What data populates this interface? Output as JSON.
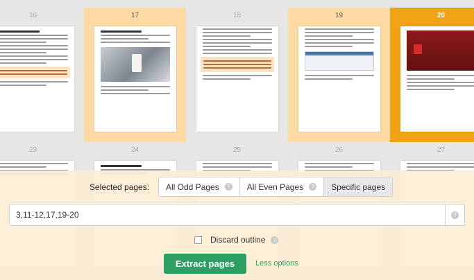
{
  "thumbnails": {
    "row1": [
      {
        "number": "16",
        "state": "normal",
        "content": "text"
      },
      {
        "number": "17",
        "state": "selected",
        "content": "photo"
      },
      {
        "number": "18",
        "state": "normal",
        "content": "highlight"
      },
      {
        "number": "19",
        "state": "selected",
        "content": "screenshot"
      },
      {
        "number": "20",
        "state": "current",
        "content": "red-screenshot"
      }
    ],
    "row2": [
      {
        "number": "23"
      },
      {
        "number": "24"
      },
      {
        "number": "25"
      },
      {
        "number": "26"
      },
      {
        "number": "27"
      }
    ]
  },
  "selection": {
    "label": "Selected pages:",
    "options": [
      {
        "label": "All Odd Pages",
        "help_icon": "help-icon"
      },
      {
        "label": "All Even Pages",
        "help_icon": "help-icon"
      },
      {
        "label": "Specific pages",
        "active": true
      }
    ]
  },
  "range_input": {
    "value": "3,11-12,17,19-20",
    "help_icon": "help-icon"
  },
  "discard_outline": {
    "label": "Discard outline",
    "checked": false,
    "help_icon": "help-icon"
  },
  "actions": {
    "extract_label": "Extract pages",
    "less_options_label": "Less options"
  },
  "colors": {
    "selected": "#fdd9a3",
    "current": "#f0a315",
    "primary": "#2e9e63",
    "panel": "#fdeed4"
  }
}
